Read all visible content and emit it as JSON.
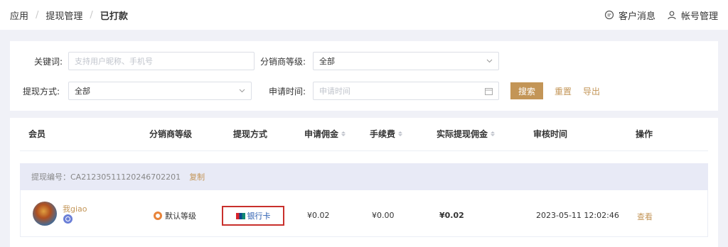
{
  "breadcrumb": {
    "items": [
      "应用",
      "提现管理",
      "已打款"
    ]
  },
  "header": {
    "messages": "客户消息",
    "account": "帐号管理"
  },
  "filter": {
    "keyword_label": "关键词:",
    "keyword_placeholder": "支持用户昵称、手机号",
    "level_label": "分销商等级:",
    "level_value": "全部",
    "method_label": "提现方式:",
    "method_value": "全部",
    "time_label": "申请时间:",
    "time_placeholder": "申请时间",
    "search_btn": "搜索",
    "reset_link": "重置",
    "export_link": "导出"
  },
  "table": {
    "columns": [
      "会员",
      "分销商等级",
      "提现方式",
      "申请佣金",
      "手续费",
      "实际提现佣金",
      "审核时间",
      "操作"
    ],
    "group": {
      "id_label": "提现编号：CA21230511120246702201",
      "copy": "复制"
    },
    "row": {
      "nickname": "我giao",
      "level": "默认等级",
      "method": "银行卡",
      "apply": "¥0.02",
      "fee": "¥0.00",
      "actual": "¥0.02",
      "time": "2023-05-11 12:02:46",
      "action": "查看"
    }
  },
  "colors": {
    "accent": "#c39557",
    "highlight_border": "#c9302c"
  }
}
